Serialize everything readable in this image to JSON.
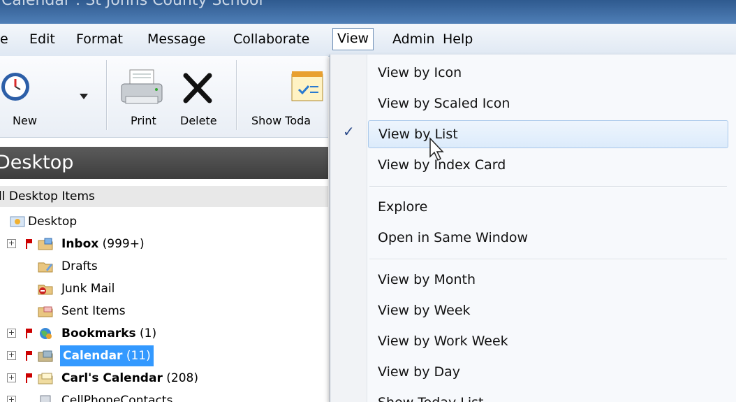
{
  "window": {
    "title": "Calendar : St Johns County School"
  },
  "menubar": {
    "items": [
      {
        "label": "e"
      },
      {
        "label": "Edit"
      },
      {
        "label": "Format"
      },
      {
        "label": "Message"
      },
      {
        "label": "Collaborate"
      },
      {
        "label": "View"
      },
      {
        "label": "Admin"
      },
      {
        "label": "Help"
      }
    ]
  },
  "toolbar": {
    "new_label": "New",
    "print_label": "Print",
    "delete_label": "Delete",
    "show_today_label": "Show Toda"
  },
  "desktop": {
    "header": "Desktop",
    "all_items": "ll Desktop Items",
    "tree": [
      {
        "label": "Desktop",
        "count": ""
      },
      {
        "label": "Inbox",
        "count": " (999+)"
      },
      {
        "label": "Drafts",
        "count": ""
      },
      {
        "label": "Junk Mail",
        "count": ""
      },
      {
        "label": "Sent Items",
        "count": ""
      },
      {
        "label": "Bookmarks",
        "count": " (1)"
      },
      {
        "label": "Calendar",
        "count": " (11)"
      },
      {
        "label": "Carl's Calendar",
        "count": " (208)"
      },
      {
        "label": "CellPhoneContacts",
        "count": ""
      }
    ]
  },
  "view_menu": {
    "items": [
      {
        "label": "View by Icon"
      },
      {
        "label": "View by Scaled Icon"
      },
      {
        "label": "View by List",
        "checked": true
      },
      {
        "label": "View by Index Card"
      },
      {
        "label": "Explore"
      },
      {
        "label": "Open in Same Window"
      },
      {
        "label": "View by Month"
      },
      {
        "label": "View by Week"
      },
      {
        "label": "View by Work Week"
      },
      {
        "label": "View by Day"
      },
      {
        "label": "Show Today List"
      }
    ],
    "check_glyph": "✓"
  },
  "colors": {
    "selection": "#3399ff",
    "title_bar": "#3a669c",
    "desktop_header": "#4a4a4a",
    "flag": "#cc0000"
  }
}
